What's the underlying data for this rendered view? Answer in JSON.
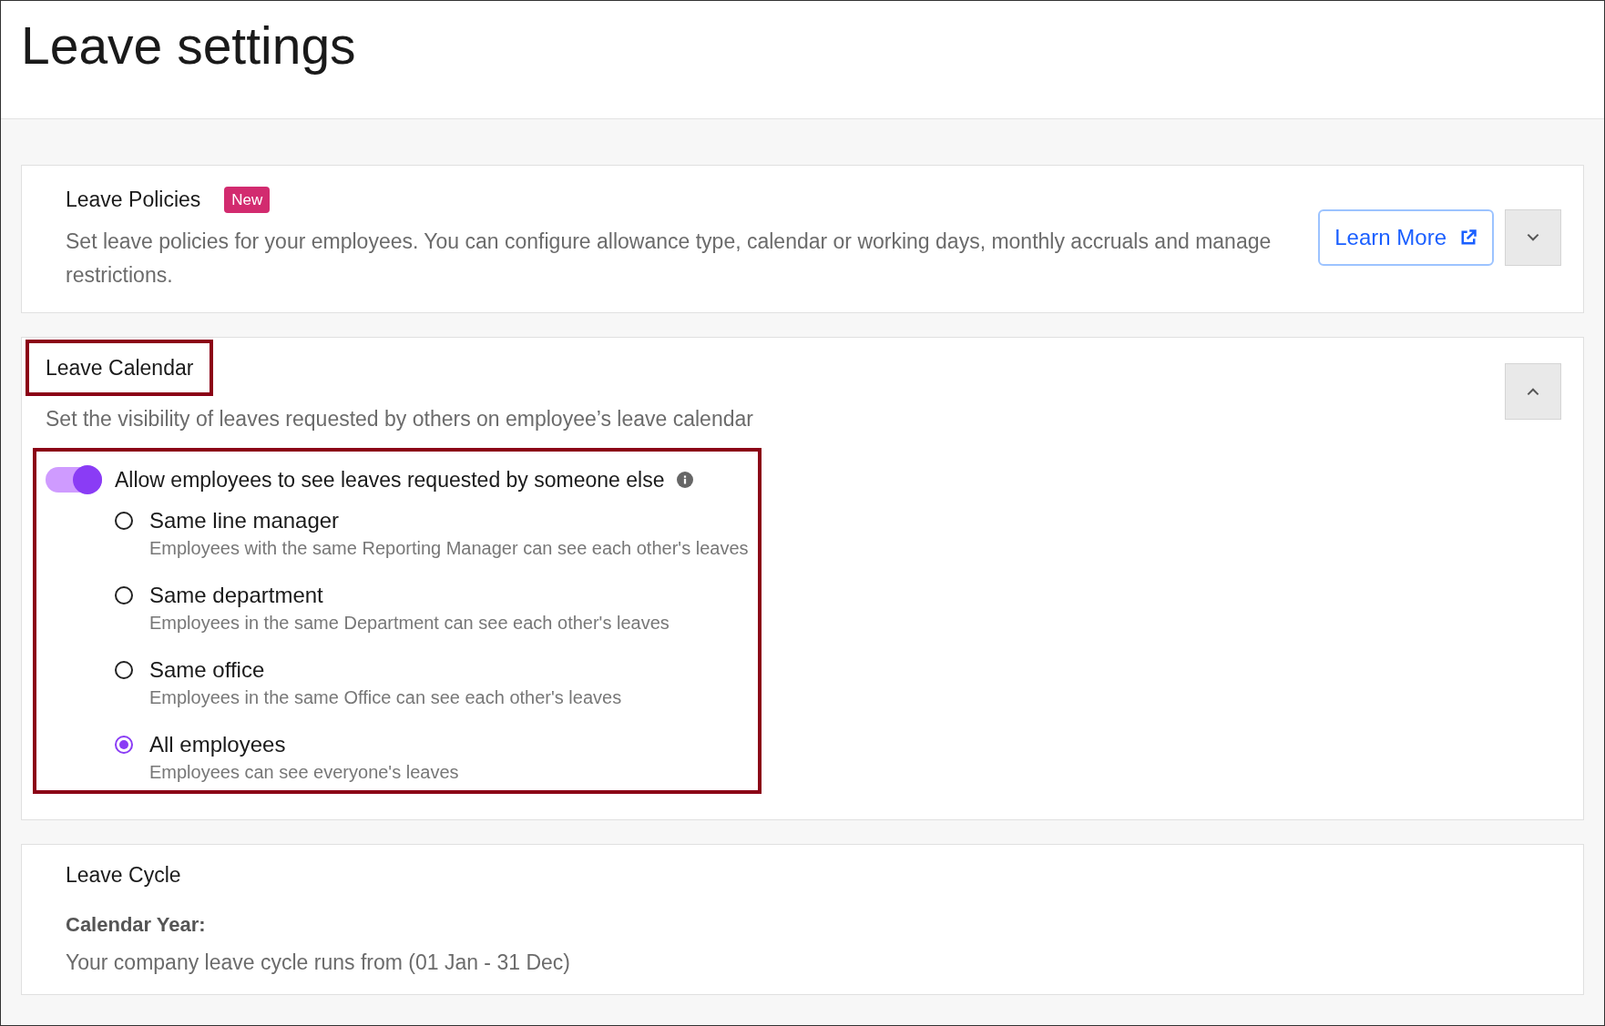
{
  "page": {
    "title": "Leave settings"
  },
  "sections": [
    {
      "kind": "policies",
      "title": "Leave Policies",
      "badge": "New",
      "description": "Set leave policies for your employees. You can configure allowance type, calendar or working days, monthly accruals and manage restrictions.",
      "link": "Learn More",
      "expanded": false,
      "highlighted": false
    },
    {
      "kind": "calendar",
      "title": "Leave Calendar",
      "description": "Set the visibility of leaves requested by others on employee’s leave calendar",
      "expanded": true,
      "highlighted": true,
      "toggle": {
        "label": "Allow employees to see leaves requested by someone else",
        "on": true
      },
      "options_highlighted": true,
      "options": [
        {
          "label": "Same line manager",
          "hint": "Employees with the same Reporting Manager can see each other's leaves",
          "selected": false
        },
        {
          "label": "Same department",
          "hint": "Employees in the same Department can see each other's leaves",
          "selected": false
        },
        {
          "label": "Same office",
          "hint": "Employees in the same Office can see each other's leaves",
          "selected": false
        },
        {
          "label": "All employees",
          "hint": "Employees can see everyone's leaves",
          "selected": true
        }
      ]
    },
    {
      "kind": "cycle",
      "title": "Leave Cycle",
      "subtitle": "Calendar Year:",
      "description": "Your company leave cycle runs from (01 Jan - 31 Dec)",
      "highlighted": false
    }
  ]
}
